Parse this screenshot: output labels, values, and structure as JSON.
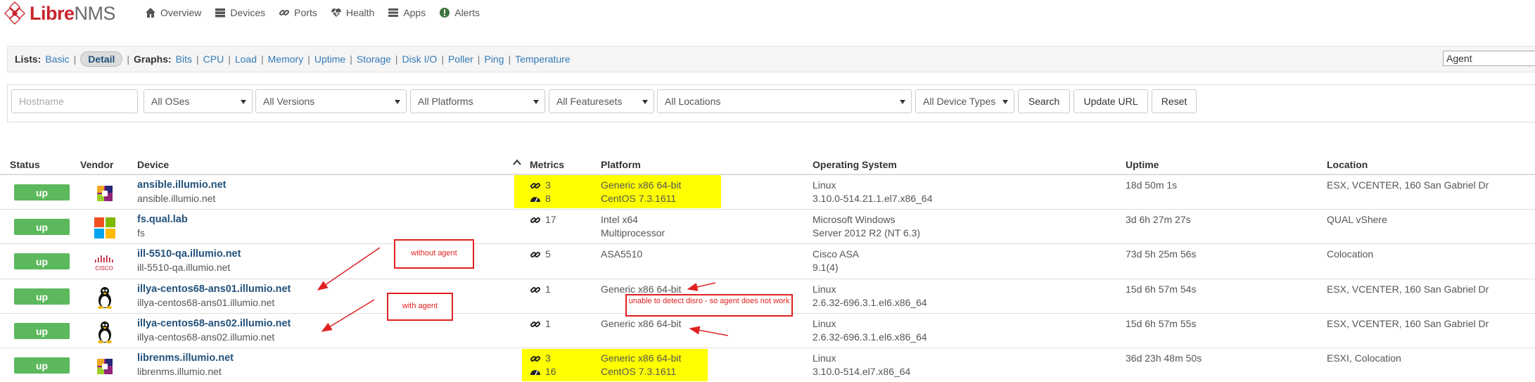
{
  "brand": {
    "libre": "Libre",
    "nms": "NMS"
  },
  "nav": [
    {
      "label": "Overview",
      "icon": "home-icon"
    },
    {
      "label": "Devices",
      "icon": "server-icon"
    },
    {
      "label": "Ports",
      "icon": "link-icon"
    },
    {
      "label": "Health",
      "icon": "heartbeat-icon"
    },
    {
      "label": "Apps",
      "icon": "tasks-icon"
    },
    {
      "label": "Alerts",
      "icon": "exclamation-circle-icon"
    }
  ],
  "lists": {
    "lists_label": "Lists:",
    "basic": "Basic",
    "detail": "Detail",
    "graphs_label": "Graphs:",
    "graphs": [
      "Bits",
      "CPU",
      "Load",
      "Memory",
      "Uptime",
      "Storage",
      "Disk I/O",
      "Poller",
      "Ping",
      "Temperature"
    ],
    "search_value": "Agent"
  },
  "filters": {
    "hostname_placeholder": "Hostname",
    "os": "All OSes",
    "versions": "All Versions",
    "platforms": "All Platforms",
    "featuresets": "All Featuresets",
    "locations": "All Locations",
    "device_types": "All Device Types",
    "search": "Search",
    "update_url": "Update URL",
    "reset": "Reset"
  },
  "table": {
    "headers": {
      "status": "Status",
      "vendor": "Vendor",
      "device": "Device",
      "metrics": "Metrics",
      "platform": "Platform",
      "os": "Operating System",
      "uptime": "Uptime",
      "location": "Location"
    },
    "rows": [
      {
        "status": "up",
        "vendor": "centos",
        "name": "ansible.illumio.net",
        "sub": "ansible.illumio.net",
        "ports": "3",
        "health": "8",
        "platform1": "Generic x86 64-bit",
        "platform2": "CentOS 7.3.1611",
        "os1": "Linux",
        "os2": "3.10.0-514.21.1.el7.x86_64",
        "uptime": "18d 50m 1s",
        "location": "ESX, VCENTER, 160 San Gabriel Dr"
      },
      {
        "status": "up",
        "vendor": "windows",
        "name": "fs.qual.lab",
        "sub": "fs",
        "ports": "17",
        "health": "",
        "platform1": "Intel x64",
        "platform2": "Multiprocessor",
        "os1": "Microsoft Windows",
        "os2": "Server 2012 R2 (NT 6.3)",
        "uptime": "3d 6h 27m 27s",
        "location": "QUAL vShere"
      },
      {
        "status": "up",
        "vendor": "cisco",
        "name": "ill-5510-qa.illumio.net",
        "sub": "ill-5510-qa.illumio.net",
        "ports": "5",
        "health": "",
        "platform1": "ASA5510",
        "platform2": "",
        "os1": "Cisco ASA",
        "os2": "9.1(4)",
        "uptime": "73d 5h 25m 56s",
        "location": "Colocation"
      },
      {
        "status": "up",
        "vendor": "linux",
        "name": "illya-centos68-ans01.illumio.net",
        "sub": "illya-centos68-ans01.illumio.net",
        "ports": "1",
        "health": "",
        "platform1": "Generic x86 64-bit",
        "platform2": "",
        "os1": "Linux",
        "os2": "2.6.32-696.3.1.el6.x86_64",
        "uptime": "15d 6h 57m 54s",
        "location": "ESX, VCENTER, 160 San Gabriel Dr"
      },
      {
        "status": "up",
        "vendor": "linux",
        "name": "illya-centos68-ans02.illumio.net",
        "sub": "illya-centos68-ans02.illumio.net",
        "ports": "1",
        "health": "",
        "platform1": "Generic x86 64-bit",
        "platform2": "",
        "os1": "Linux",
        "os2": "2.6.32-696.3.1.el6.x86_64",
        "uptime": "15d 6h 57m 55s",
        "location": "ESX, VCENTER, 160 San Gabriel Dr"
      },
      {
        "status": "up",
        "vendor": "centos",
        "name": "librenms.illumio.net",
        "sub": "librenms.illumio.net",
        "ports": "3",
        "health": "16",
        "platform1": "Generic x86 64-bit",
        "platform2": "CentOS 7.3.1611",
        "os1": "Linux",
        "os2": "3.10.0-514.el7.x86_64",
        "uptime": "36d 23h 48m 50s",
        "location": "ESXI, Colocation"
      }
    ]
  },
  "annotations": {
    "without_agent": "without agent",
    "with_agent": "with agent",
    "distro": "unable to detect disro - so agent does not work"
  },
  "colors": {
    "up": "#5cb85c",
    "highlight": "#ffff00",
    "annotation": "#e02020",
    "link": "#23527c"
  }
}
